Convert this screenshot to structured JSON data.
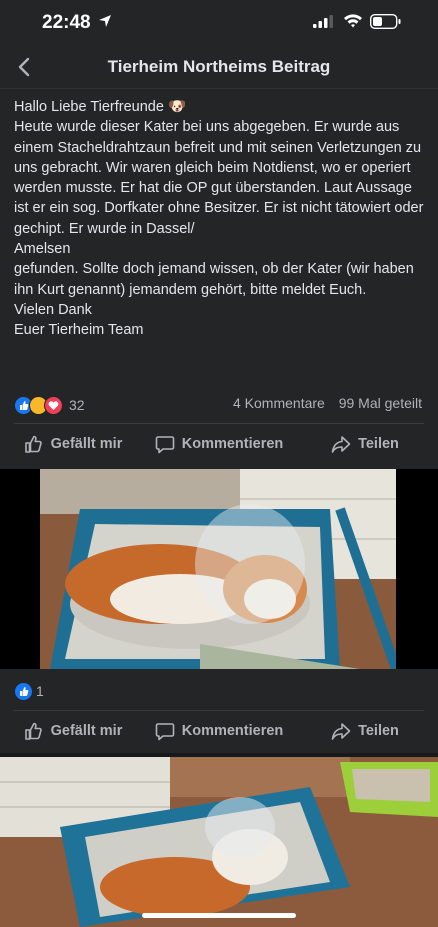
{
  "status_bar": {
    "time": "22:48"
  },
  "header": {
    "title": "Tierheim Northeims Beitrag"
  },
  "post": {
    "text": "Hallo Liebe Tierfreunde 🐶\nHeute wurde dieser Kater bei uns abgegeben. Er wurde aus einem Stacheldrahtzaun befreit und mit seinen Verletzungen zu uns gebracht. Wir waren gleich beim Notdienst, wo er operiert werden musste. Er hat die OP gut überstanden. Laut Aussage ist er ein sog. Dorfkater ohne Besitzer. Er ist nicht tätowiert oder gechipt. Er wurde in Dassel/\nAmelsen\ngefunden. Sollte doch jemand wissen, ob der Kater (wir haben ihn Kurt genannt) jemandem gehört, bitte meldet Euch.\nVielen Dank\nEuer Tierheim Team",
    "reaction_count": "32",
    "comments": "4 Kommentare",
    "shares": "99 Mal geteilt"
  },
  "actions": {
    "like": "Gefällt mir",
    "comment": "Kommentieren",
    "share": "Teilen"
  },
  "photo1": {
    "reaction_count": "1"
  },
  "colors": {
    "background": "#18191a",
    "card": "#242526",
    "text": "#e4e6eb",
    "muted": "#b0b3b8",
    "like_blue": "#1877f2"
  }
}
